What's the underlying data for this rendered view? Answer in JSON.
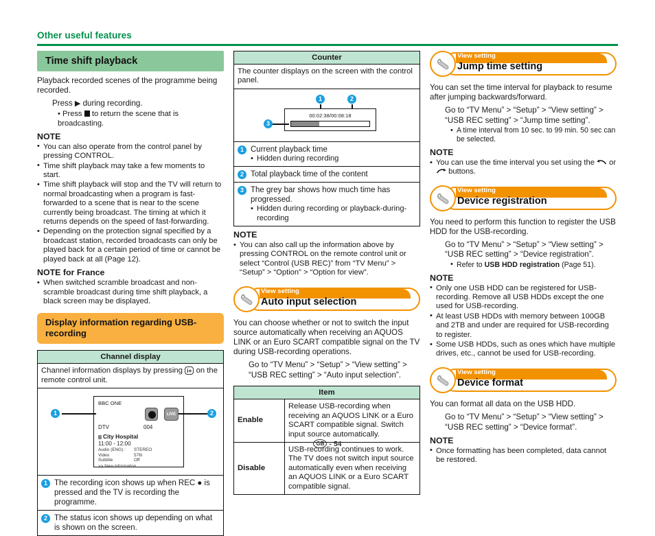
{
  "runhead": {
    "title": "Other useful features"
  },
  "col1": {
    "heading": "Time shift playback",
    "intro": "Playback recorded scenes of the programme being recorded.",
    "step": "during recording.",
    "step_pre": "Press",
    "substep_pre": "Press",
    "substep": "to return the scene that is broadcasting.",
    "note_label": "NOTE",
    "notes": [
      "You can also operate from the control panel by pressing CONTROL.",
      "Time shift playback may take a few moments to start.",
      "Time shift playback will stop and the TV will return to normal broadcasting when a program is fast-forwarded to a scene that is near to the scene currently being broadcast. The timing at which it returns depends on the speed of fast-forwarding.",
      "Depending on the protection signal specified by a broadcast station, recorded broadcasts can only be played back for a certain period of time or cannot be played back at all (Page 12)."
    ],
    "note_france_label": "NOTE for France",
    "note_france": "When switched scramble broadcast and non-scramble broadcast during time shift playback, a black screen may be displayed.",
    "orange_heading": "Display information regarding USB-recording",
    "table_header": "Channel display",
    "table_intro_pre": "Channel information displays by pressing",
    "table_intro_icon": "i+",
    "table_intro_post": "on the remote control unit.",
    "tv": {
      "channel": "BBC ONE",
      "live": "LIVE",
      "source": "DTV",
      "number": "004",
      "programme": "City Hospital",
      "time": "11:00 - 12:00",
      "rows": [
        {
          "key": "Audio (ENG)  :",
          "value": "STEREO"
        },
        {
          "key": "Video",
          "value": "576i"
        },
        {
          "key": "Subtitle",
          "value": "Off"
        }
      ],
      "new_info": ">> New information",
      "badge1": "1",
      "badge2": "2"
    },
    "callouts": [
      {
        "num": "1",
        "text": "The recording icon shows up when REC ● is pressed and the TV is recording the programme."
      },
      {
        "num": "2",
        "text": "The status icon shows up depending on what is shown on the screen."
      }
    ]
  },
  "col2": {
    "table_header": "Counter",
    "table_intro": "The counter displays on the screen with the control panel.",
    "counter": {
      "time": "00:02:38/00:08:18",
      "badge1": "1",
      "badge2": "2",
      "badge3": "3"
    },
    "callouts": [
      {
        "num": "1",
        "text": "Current playback time",
        "sub": "Hidden during recording"
      },
      {
        "num": "2",
        "text": "Total playback time of the content",
        "sub": ""
      },
      {
        "num": "3",
        "text": "The grey bar shows how much time has progressed.",
        "sub": "Hidden during recording or playback-during-recording"
      }
    ],
    "note_label": "NOTE",
    "note": "You can also call up the information above by pressing CONTROL on the remote control unit or select “Control (USB REC)” from “TV Menu” > “Setup” > “Option” > “Option for view”.",
    "vs_kicker": "View setting",
    "vs_title": "Auto input selection",
    "vs_body": "You can choose whether or not to switch the input source automatically when receiving an AQUOS LINK or an Euro SCART compatible signal on the TV during USB-recording operations.",
    "vs_path_line1": "Go to “TV Menu” > “Setup” > “View setting” >",
    "vs_path_line2": "“USB REC setting” > “Auto input selection”.",
    "item_header": "Item",
    "items": [
      {
        "label": "Enable",
        "desc": "Release USB-recording when receiving an AQUOS LINK or a Euro SCART compatible signal. Switch input source automatically."
      },
      {
        "label": "Disable",
        "desc": "USB-recording continues to work. The TV does not switch input source automatically even when receiving an AQUOS LINK or a Euro SCART compatible signal."
      }
    ]
  },
  "col3": {
    "jump": {
      "kicker": "View setting",
      "title": "Jump time setting",
      "body": "You can set the time interval for playback to resume after jumping backwards/forward.",
      "path_line1": "Go to “TV Menu” > “Setup” > “View setting” >",
      "path_line2": "“USB REC setting” > “Jump time setting”.",
      "bullet": "A time interval from 10 sec. to 99 min. 50 sec can be selected.",
      "note_label": "NOTE",
      "note_pre": "You can use the time interval you set using the",
      "note_mid": "or",
      "note_post": "buttons."
    },
    "registration": {
      "kicker": "View setting",
      "title": "Device registration",
      "body": "You need to perform this function to register the USB HDD for the USB-recording.",
      "path_line1": "Go to “TV Menu” > “Setup” > “View setting” >",
      "path_line2": "“USB REC setting” > “Device registration”.",
      "bullet_pre": "Refer to",
      "bullet_bold": "USB HDD registration",
      "bullet_post": "(Page 51).",
      "note_label": "NOTE",
      "notes": [
        "Only one USB HDD can be registered for USB-recording. Remove all USB HDDs except the one used for USB-recording.",
        "At least USB HDDs with memory between 100GB and 2TB and under are required for USB-recording to register.",
        "Some USB HDDs, such as ones which have multiple drives, etc., cannot be used for USB-recording."
      ]
    },
    "format": {
      "kicker": "View setting",
      "title": "Device format",
      "body": "You can format all data on the USB HDD.",
      "path_line1": "Go to “TV Menu” > “Setup” > “View setting” >",
      "path_line2": "“USB REC setting” > “Device format”.",
      "note_label": "NOTE",
      "note": "Once formatting has been completed, data cannot be restored."
    }
  },
  "footer": {
    "region": "GB",
    "page": "- 54"
  },
  "colors": {
    "green": "#00914a",
    "green_band": "#8ac79a",
    "mint": "#bfe4d2",
    "orange": "#f39200",
    "orange_band": "#f9b040",
    "blue_badge": "#1a9fe0"
  }
}
